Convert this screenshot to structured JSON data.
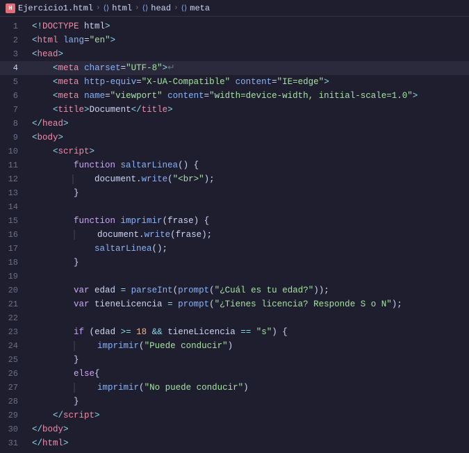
{
  "breadcrumb": {
    "file": "Ejercicio1.html",
    "items": [
      "html",
      "head",
      "meta"
    ]
  },
  "lines": [
    {
      "num": 1,
      "active": false
    },
    {
      "num": 2,
      "active": false
    },
    {
      "num": 3,
      "active": false
    },
    {
      "num": 4,
      "active": true
    },
    {
      "num": 5,
      "active": false
    },
    {
      "num": 6,
      "active": false
    },
    {
      "num": 7,
      "active": false
    },
    {
      "num": 8,
      "active": false
    },
    {
      "num": 9,
      "active": false
    },
    {
      "num": 10,
      "active": false
    },
    {
      "num": 11,
      "active": false
    },
    {
      "num": 12,
      "active": false
    },
    {
      "num": 13,
      "active": false
    },
    {
      "num": 14,
      "active": false
    },
    {
      "num": 15,
      "active": false
    },
    {
      "num": 16,
      "active": false
    },
    {
      "num": 17,
      "active": false
    },
    {
      "num": 18,
      "active": false
    },
    {
      "num": 19,
      "active": false
    },
    {
      "num": 20,
      "active": false
    },
    {
      "num": 21,
      "active": false
    },
    {
      "num": 22,
      "active": false
    },
    {
      "num": 23,
      "active": false
    },
    {
      "num": 24,
      "active": false
    },
    {
      "num": 25,
      "active": false
    },
    {
      "num": 26,
      "active": false
    },
    {
      "num": 27,
      "active": false
    },
    {
      "num": 28,
      "active": false
    },
    {
      "num": 29,
      "active": false
    },
    {
      "num": 30,
      "active": false
    },
    {
      "num": 31,
      "active": false
    }
  ]
}
